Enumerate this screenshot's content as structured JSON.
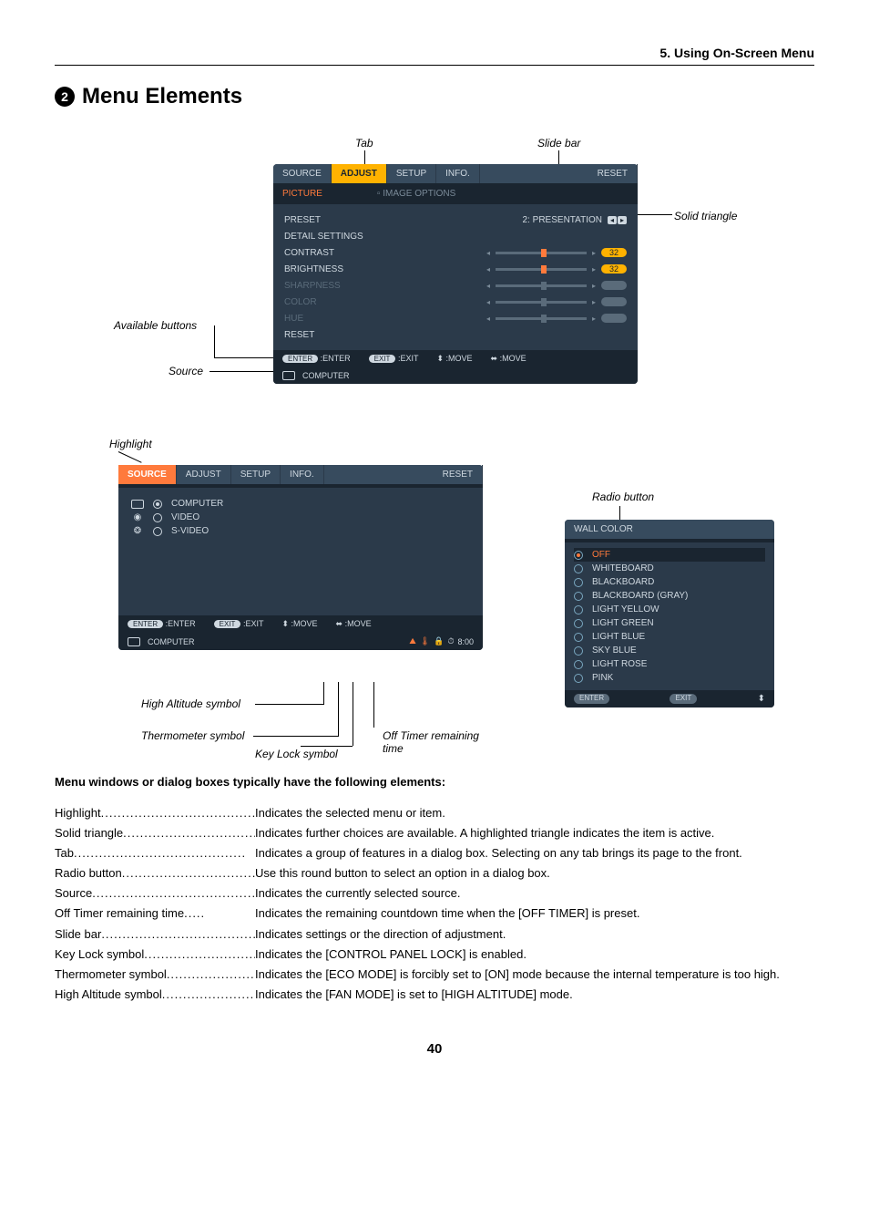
{
  "header": {
    "section_title": "5. Using On-Screen Menu"
  },
  "title": {
    "bullet": "2",
    "text": "Menu Elements"
  },
  "figure1": {
    "labels": {
      "tab": "Tab",
      "slide_bar": "Slide bar",
      "solid_triangle": "Solid triangle",
      "available_buttons": "Available buttons",
      "source": "Source"
    },
    "tabs": [
      "SOURCE",
      "ADJUST",
      "SETUP",
      "INFO.",
      "RESET"
    ],
    "sub_tabs": [
      "PICTURE",
      "IMAGE OPTIONS"
    ],
    "rows": [
      {
        "label": "PRESET",
        "value": "2: PRESENTATION",
        "type": "preset"
      },
      {
        "label": "DETAIL SETTINGS",
        "type": "none"
      },
      {
        "label": "CONTRAST",
        "value": "32",
        "type": "slider"
      },
      {
        "label": "BRIGHTNESS",
        "value": "32",
        "type": "slider"
      },
      {
        "label": "SHARPNESS",
        "type": "slider-disabled"
      },
      {
        "label": "COLOR",
        "type": "slider-disabled"
      },
      {
        "label": "HUE",
        "type": "slider-disabled"
      },
      {
        "label": "RESET",
        "type": "none"
      }
    ],
    "footer": {
      "enter": "ENTER",
      "enter_label": ":ENTER",
      "exit": "EXIT",
      "exit_label": ":EXIT",
      "move1": ":MOVE",
      "move2": ":MOVE"
    },
    "source_footer": "COMPUTER"
  },
  "figure2": {
    "labels": {
      "highlight": "Highlight",
      "radio_button": "Radio button",
      "high_altitude": "High Altitude symbol",
      "thermometer": "Thermometer symbol",
      "key_lock": "Key Lock symbol",
      "off_timer": "Off Timer remaining time"
    },
    "tabs": [
      "SOURCE",
      "ADJUST",
      "SETUP",
      "INFO.",
      "RESET"
    ],
    "sources": [
      {
        "label": "COMPUTER",
        "selected": true
      },
      {
        "label": "VIDEO",
        "selected": false
      },
      {
        "label": "S-VIDEO",
        "selected": false
      }
    ],
    "footer": {
      "enter": "ENTER",
      "enter_label": ":ENTER",
      "exit": "EXIT",
      "exit_label": ":EXIT",
      "move1": ":MOVE",
      "move2": ":MOVE"
    },
    "source_footer": "COMPUTER",
    "timer": "8:00",
    "wall": {
      "title": "WALL COLOR",
      "items": [
        "OFF",
        "WHITEBOARD",
        "BLACKBOARD",
        "BLACKBOARD (GRAY)",
        "LIGHT YELLOW",
        "LIGHT GREEN",
        "LIGHT BLUE",
        "SKY BLUE",
        "LIGHT ROSE",
        "PINK"
      ],
      "footer_enter": "ENTER",
      "footer_exit": "EXIT"
    }
  },
  "description": {
    "heading": "Menu windows or dialog boxes typically have the following elements:",
    "items": [
      {
        "term": "Highlight",
        "def": "Indicates the selected menu or item."
      },
      {
        "term": "Solid triangle",
        "def": "Indicates further choices are available. A highlighted triangle indicates the item is active."
      },
      {
        "term": "Tab",
        "def": "Indicates a group of features in a dialog box. Selecting on any tab brings its page to the front."
      },
      {
        "term": "Radio button",
        "def": "Use this round button to select an option in a dialog box."
      },
      {
        "term": "Source",
        "def": "Indicates the currently selected source."
      },
      {
        "term": "Off Timer remaining time",
        "def": "Indicates the remaining countdown time when the [OFF TIMER] is preset."
      },
      {
        "term": "Slide bar",
        "def": "Indicates settings or the direction of adjustment."
      },
      {
        "term": "Key Lock symbol",
        "def": "Indicates the [CONTROL PANEL LOCK] is enabled."
      },
      {
        "term": "Thermometer symbol",
        "def": "Indicates the [ECO MODE] is forcibly set to [ON] mode because the internal temperature is too high."
      },
      {
        "term": "High Altitude symbol",
        "def": "Indicates the [FAN MODE] is set to [HIGH ALTITUDE] mode."
      }
    ]
  },
  "page_number": "40"
}
